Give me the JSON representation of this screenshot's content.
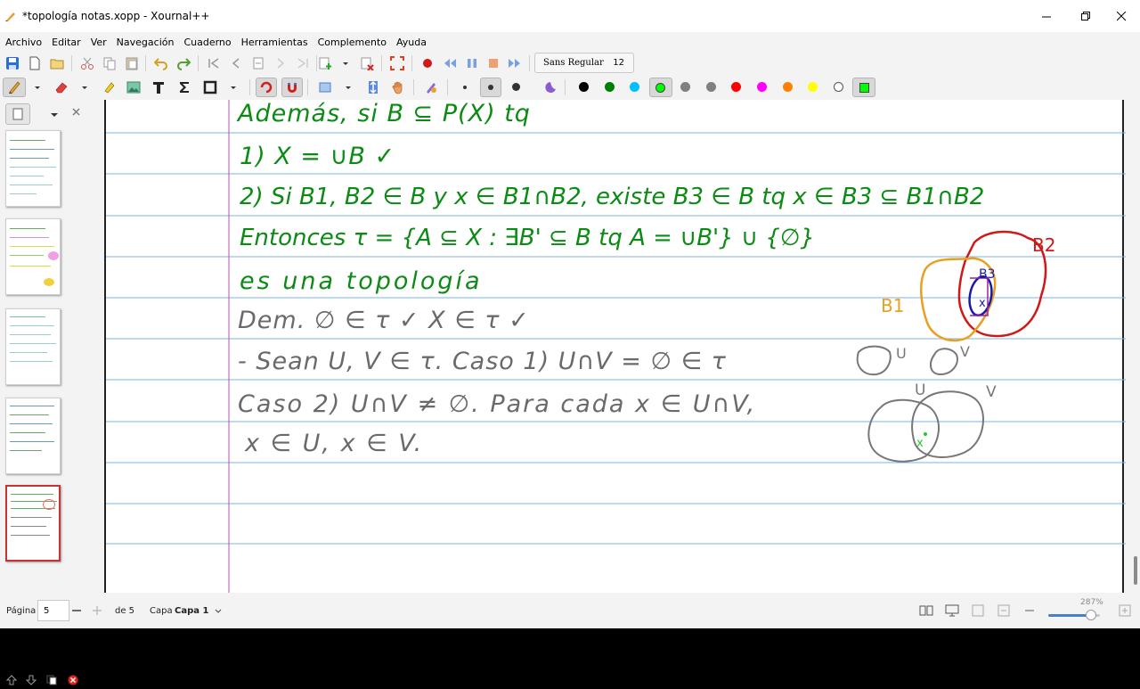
{
  "window": {
    "title": "*topología notas.xopp - Xournal++"
  },
  "menu": [
    "Archivo",
    "Editar",
    "Ver",
    "Navegación",
    "Cuaderno",
    "Herramientas",
    "Complemento",
    "Ayuda"
  ],
  "toolbar": {
    "font_name": "Sans Regular",
    "font_size": "12"
  },
  "palette": [
    "#000000",
    "#008000",
    "#00c0ff",
    "#00ff00",
    "#808080",
    "#808080",
    "#ff0000",
    "#ff00ff",
    "#ff8000",
    "#ffff00",
    "#ffffff",
    "#00ff00"
  ],
  "status": {
    "page_label": "Página",
    "page_value": "5",
    "page_of": "de 5",
    "layer_label": "Capa",
    "layer_value": "Capa 1",
    "zoom": "287%"
  },
  "notes": {
    "line1": "Además, si B ⊆ P(X) tq",
    "line2": "1) X = ∪B ✓",
    "line3": "2) Si B1, B2 ∈ B y x ∈ B1∩B2, existe B3 ∈ B tq x ∈ B3 ⊆ B1∩B2",
    "line4": "Entonces τ = {A ⊆ X : ∃B' ⊆ B tq A = ∪B'} ∪ {∅}",
    "line5": "es una topología",
    "line6": "Dem. ∅ ∈ τ ✓   X ∈ τ ✓",
    "line7": "- Sean U, V ∈ τ.  Caso 1)  U∩V = ∅ ∈ τ",
    "line8": "Caso 2) U∩V ≠ ∅. Para cada x ∈ U∩V,",
    "line9": "x ∈ U, x ∈ V.",
    "lbl_b2": "B2",
    "lbl_b1": "B1",
    "lbl_b3": "B3",
    "lbl_x": "x",
    "lbl_u1": "U",
    "lbl_v1": "V",
    "lbl_u2": "U",
    "lbl_v2": "V",
    "lbl_x2": "x"
  }
}
